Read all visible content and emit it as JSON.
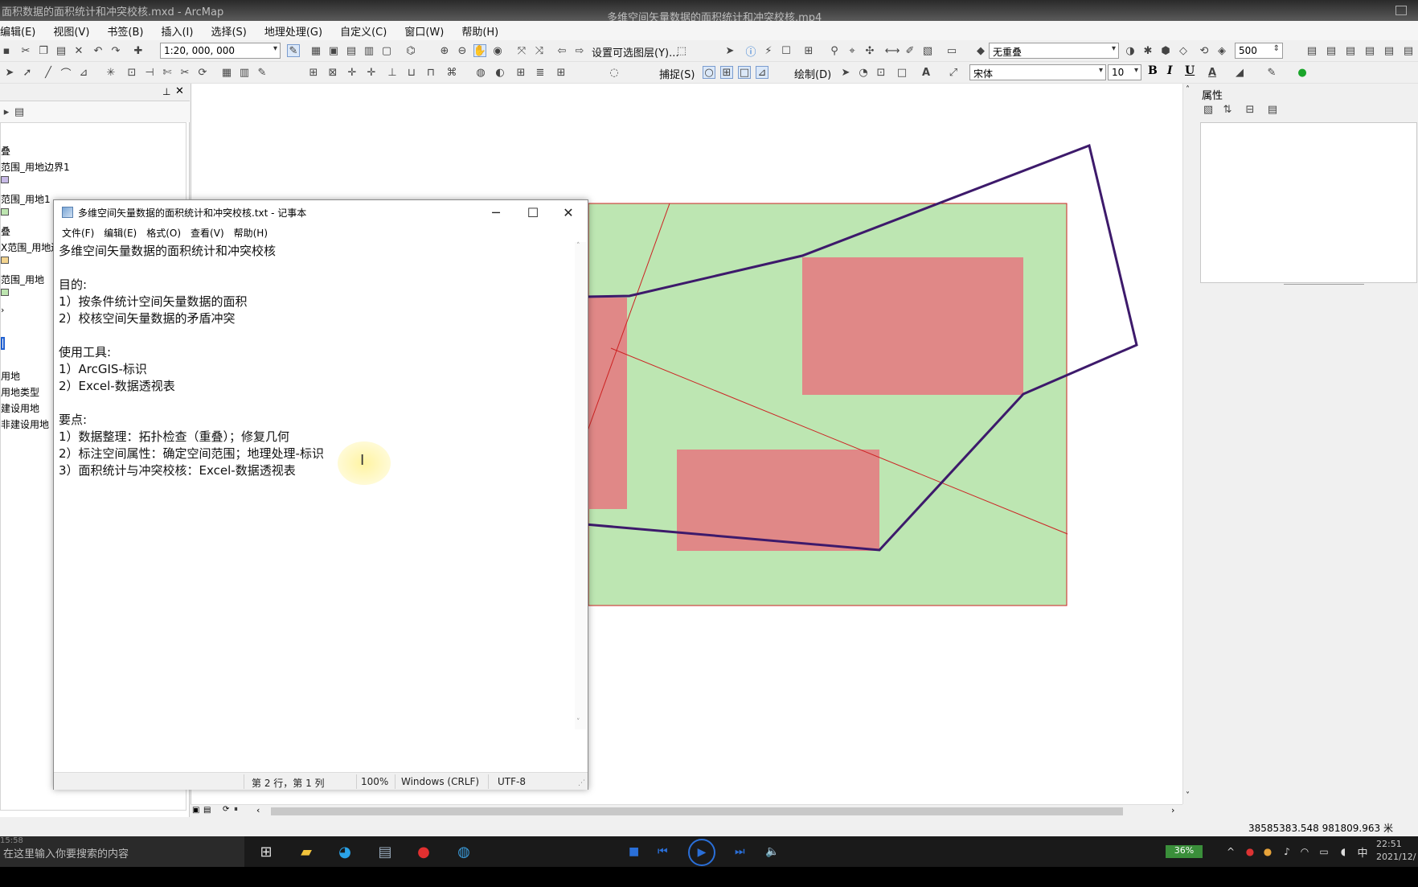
{
  "titlebar": {
    "app_title": "面积数据的面积统计和冲突校核.mxd - ArcMap",
    "video_title": "多维空间矢量数据的面积统计和冲突校核.mp4"
  },
  "menubar": {
    "items": [
      "编辑(E)",
      "视图(V)",
      "书签(B)",
      "插入(I)",
      "选择(S)",
      "地理处理(G)",
      "自定义(C)",
      "窗口(W)",
      "帮助(H)"
    ]
  },
  "toolbar": {
    "scale": "1:20, 000, 000",
    "selectable_layers": "设置可选图层(Y)...",
    "no_overlap": "无重叠",
    "snap_value": "500",
    "snapping": "捕捉(S)",
    "drawing": "绘制(D)",
    "font": "宋体",
    "font_size": "10",
    "bold": "B",
    "italic": "I",
    "underline": "U"
  },
  "toc": {
    "entries": [
      "叠",
      "范围_用地边界1",
      "范围_用地1",
      "叠",
      "X范围_用地边",
      "范围_用地",
      "用地",
      "用地类型",
      "建设用地",
      "非建设用地"
    ],
    "colors": [
      "#c7b9e6",
      "#bde5b0",
      "#f3d48f",
      "#bde5b0"
    ]
  },
  "attributes": {
    "title": "属性"
  },
  "coords": "38585383.548  981809.963 米",
  "map": {
    "colors": {
      "fill_green": "#bde6b2",
      "fill_pink": "#e08887",
      "outline_red": "#cc2222",
      "polygon_purple": "#3d1a6b"
    }
  },
  "notepad": {
    "title": "多维空间矢量数据的面积统计和冲突校核.txt - 记事本",
    "menus": [
      "文件(F)",
      "编辑(E)",
      "格式(O)",
      "查看(V)",
      "帮助(H)"
    ],
    "lines": [
      "多维空间矢量数据的面积统计和冲突校核",
      "",
      "目的:",
      "1）按条件统计空间矢量数据的面积",
      "2）校核空间矢量数据的矛盾冲突",
      "",
      "使用工具:",
      "1）ArcGIS-标识",
      "2）Excel-数据透视表",
      "",
      "要点:",
      "1）数据整理：拓扑检查（重叠）；修复几何",
      "2）标注空间属性：确定空间范围；地理处理-标识",
      "3）面积统计与冲突校核：Excel-数据透视表"
    ],
    "status": {
      "position": "第 2 行，第 1 列",
      "zoom": "100%",
      "line_ending": "Windows (CRLF)",
      "encoding": "UTF-8"
    }
  },
  "taskbar": {
    "search_placeholder": "在这里输入你要搜索的内容",
    "overlay_time": "15:58",
    "battery": "36%",
    "ime": "中",
    "clock": "22:51",
    "date": "2021/12/"
  }
}
